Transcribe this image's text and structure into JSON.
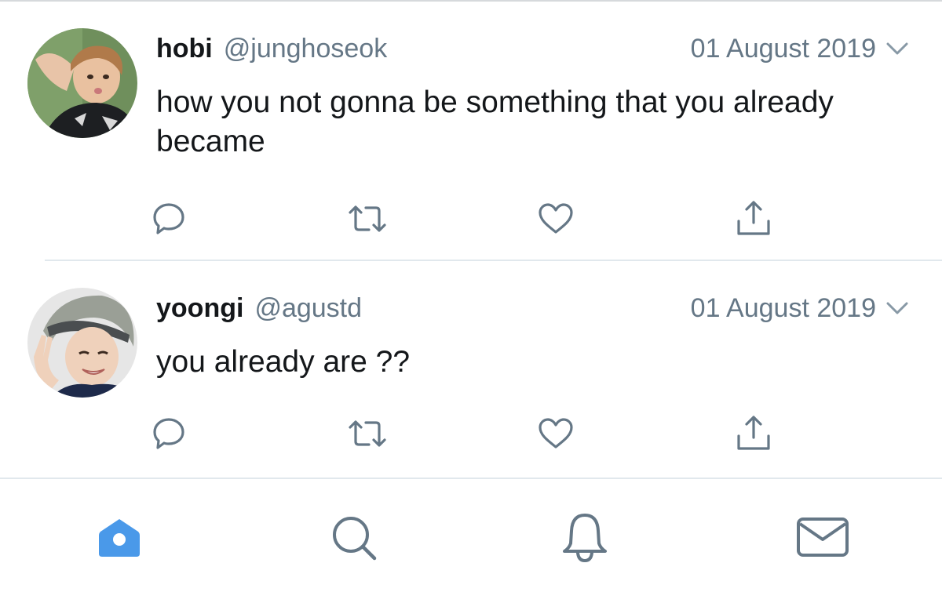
{
  "tweets": [
    {
      "name": "hobi",
      "handle": "@junghoseok",
      "date": "01 August 2019",
      "text": "how you not gonna be something that you already became",
      "avatar": "profile-photo"
    },
    {
      "name": "yoongi",
      "handle": "@agustd",
      "date": "01 August 2019",
      "text": "you already are ??",
      "avatar": "profile-photo"
    }
  ],
  "actions": [
    "reply-icon",
    "retweet-icon",
    "like-icon",
    "share-icon"
  ],
  "tabbar": {
    "items": [
      "home-icon",
      "search-icon",
      "notifications-icon",
      "messages-icon"
    ],
    "active": "home-icon"
  },
  "colors": {
    "text": "#14171a",
    "secondary": "#657786",
    "accent": "#4a99e9",
    "divider": "#e1e8ed"
  }
}
